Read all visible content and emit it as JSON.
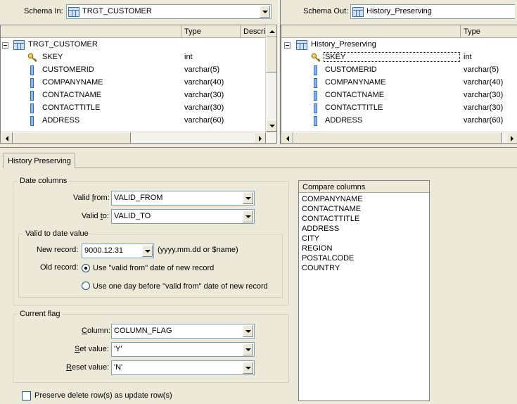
{
  "schema_in": {
    "label": "Schema In:",
    "value": "TRGT_CUSTOMER",
    "headers": {
      "type": "Type",
      "descr": "Descri"
    },
    "root": "TRGT_CUSTOMER",
    "rows": [
      {
        "name": "SKEY",
        "type": "int",
        "icon": "key-icon"
      },
      {
        "name": "CUSTOMERID",
        "type": "varchar(5)",
        "icon": "column-icon"
      },
      {
        "name": "COMPANYNAME",
        "type": "varchar(40)",
        "icon": "column-icon"
      },
      {
        "name": "CONTACTNAME",
        "type": "varchar(30)",
        "icon": "column-icon"
      },
      {
        "name": "CONTACTTITLE",
        "type": "varchar(30)",
        "icon": "column-icon"
      },
      {
        "name": "ADDRESS",
        "type": "varchar(60)",
        "icon": "column-icon"
      }
    ]
  },
  "schema_out": {
    "label": "Schema Out:",
    "value": "History_Preserving",
    "headers": {
      "type": "Type"
    },
    "root": "History_Preserving",
    "rows": [
      {
        "name": "SKEY",
        "type": "int",
        "icon": "key-icon"
      },
      {
        "name": "CUSTOMERID",
        "type": "varchar(5)",
        "icon": "column-icon"
      },
      {
        "name": "COMPANYNAME",
        "type": "varchar(40)",
        "icon": "column-icon"
      },
      {
        "name": "CONTACTNAME",
        "type": "varchar(30)",
        "icon": "column-icon"
      },
      {
        "name": "CONTACTTITLE",
        "type": "varchar(30)",
        "icon": "column-icon"
      },
      {
        "name": "ADDRESS",
        "type": "varchar(60)",
        "icon": "column-icon"
      }
    ]
  },
  "tab": {
    "label": "History Preserving"
  },
  "date_columns": {
    "legend": "Date columns",
    "valid_from_label": "Valid from:",
    "valid_from_value": "VALID_FROM",
    "valid_to_label": "Valid to:",
    "valid_to_value": "VALID_TO",
    "valid_to_date": {
      "legend": "Valid to date value",
      "new_record_label": "New record:",
      "new_record_value": "9000.12.31",
      "new_record_hint": "(yyyy.mm.dd or $name)",
      "old_record_label": "Old record:",
      "option1": "Use \"valid from\" date of new record",
      "option2": "Use one day before \"valid from\" date of new record",
      "selected": 1
    }
  },
  "current_flag": {
    "legend": "Current flag",
    "column_label": "Column:",
    "column_value": "COLUMN_FLAG",
    "set_label": "Set value:",
    "set_value": "'Y'",
    "reset_label": "Reset value:",
    "reset_value": "'N'"
  },
  "preserve_delete": {
    "label": "Preserve delete row(s) as update row(s)",
    "checked": false
  },
  "compare_columns": {
    "header": "Compare columns",
    "items": [
      "COMPANYNAME",
      "CONTACTNAME",
      "CONTACTTITLE",
      "ADDRESS",
      "CITY",
      "REGION",
      "POSTALCODE",
      "COUNTRY"
    ]
  }
}
